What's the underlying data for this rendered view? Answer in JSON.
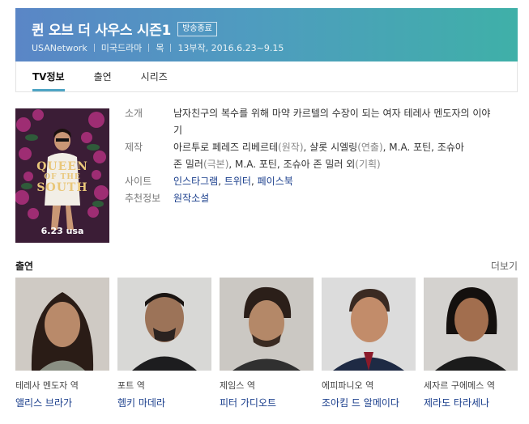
{
  "header": {
    "title": "퀸 오브 더 사우스 시즌1",
    "status_badge": "방송종료",
    "network": "USANetwork",
    "genre": "미국드라마",
    "day": "목",
    "episodes_dates": "13부작, 2016.6.23~9.15"
  },
  "tabs": [
    {
      "label": "TV정보",
      "active": true
    },
    {
      "label": "출연",
      "active": false
    },
    {
      "label": "시리즈",
      "active": false
    }
  ],
  "poster": {
    "title_line1": "QUEEN",
    "title_line2": "SOUTH",
    "date": "6.23 usa"
  },
  "info": {
    "synopsis_label": "소개",
    "synopsis": "남자친구의 복수를 위해 마약 카르텔의 수장이 되는 여자 테레사 멘도자의 이야기",
    "production_label": "제작",
    "production_line1": {
      "name1": "아르투로 페레즈 리베르테",
      "role1": "(원작)",
      "sep1": ", ",
      "name2": "샬롯 시엘링",
      "role2": "(연출)",
      "sep2": ", ",
      "name3": "M.A. 포틴",
      "sep3": ", ",
      "name4": "조슈아"
    },
    "production_line2": {
      "name1": "존 밀러",
      "role1": "(극본)",
      "sep1": ", ",
      "name2": "M.A. 포틴",
      "sep2": ", ",
      "name3": "조슈아 존 밀러 외",
      "role3": "(기획)"
    },
    "site_label": "사이트",
    "sites": [
      "인스타그램",
      "트위터",
      "페이스북"
    ],
    "site_sep": ", ",
    "recommend_label": "추천정보",
    "recommend": "원작소설"
  },
  "cast_section": {
    "title": "출연",
    "more_label": "더보기",
    "members": [
      {
        "role": "테레사 멘도자 역",
        "name": "앨리스 브라가"
      },
      {
        "role": "포트 역",
        "name": "헴키 마데라"
      },
      {
        "role": "제임스 역",
        "name": "피터 가디오트"
      },
      {
        "role": "에피파니오 역",
        "name": "조아킴 드 알메이다"
      },
      {
        "role": "세자르 구에메스 역",
        "name": "제라도 타라세나"
      }
    ]
  },
  "colors": {
    "header_gradient_start": "#5a86c6",
    "header_gradient_end": "#3fb0a8",
    "link": "#1a3e8c",
    "tab_underline": "#4ea4c4"
  }
}
